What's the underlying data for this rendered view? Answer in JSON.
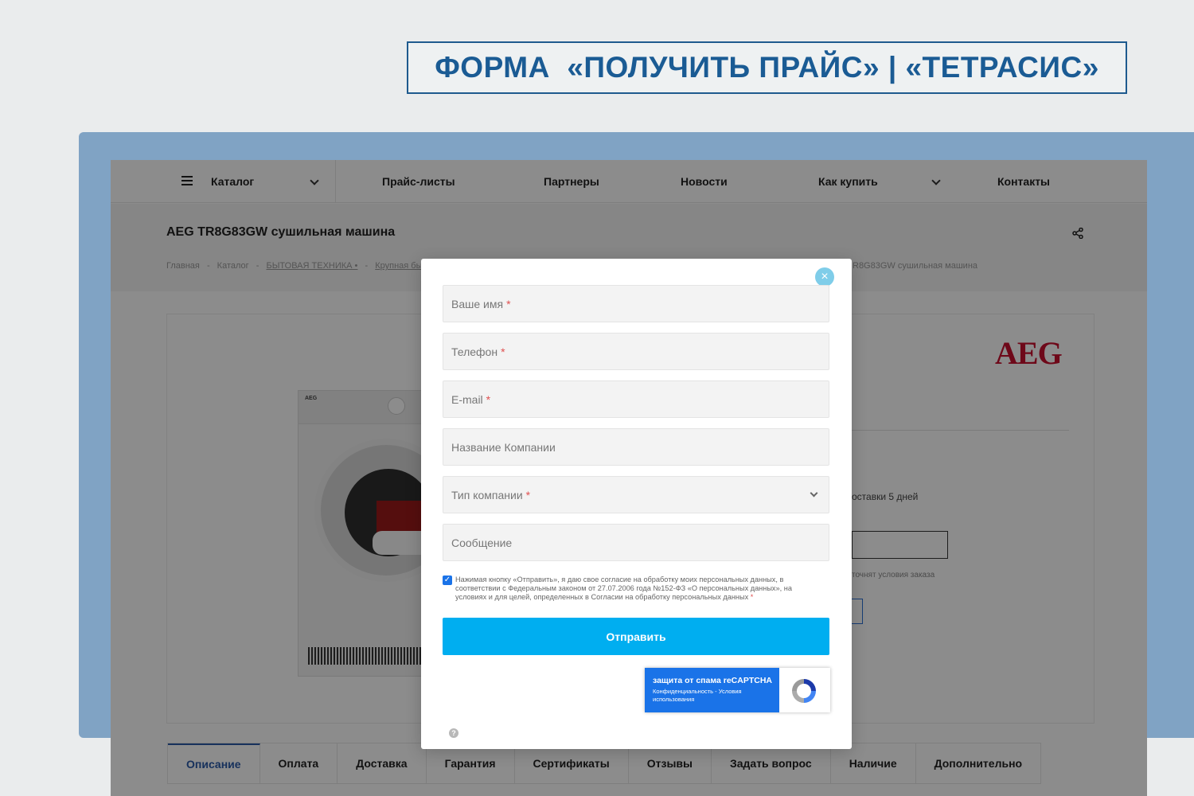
{
  "slide": {
    "title": "ФОРМА  «ПОЛУЧИТЬ ПРАЙС» | «ТЕТРАСИС»"
  },
  "nav": {
    "items": [
      "Каталог",
      "Прайс-листы",
      "Партнеры",
      "Новости",
      "Как купить",
      "Контакты"
    ]
  },
  "product": {
    "title": "AEG TR8G83GW сушильная машина",
    "breadcrumbs": [
      "Главная",
      "-",
      "Каталог",
      "-",
      "БЫТОВАЯ ТЕХНИКА •",
      "-",
      "Крупная бытова"
    ],
    "breadcrumb_tail": "R8G83GW сушильная машина",
    "brand": "AEG",
    "washer_brand": "AEG",
    "delivery": "оставки 5 дней",
    "terms_note": "точнят условия заказа"
  },
  "tabs": [
    "Описание",
    "Оплата",
    "Доставка",
    "Гарантия",
    "Сертификаты",
    "Отзывы",
    "Задать вопрос",
    "Наличие",
    "Дополнительно"
  ],
  "modal": {
    "close": "×",
    "fields": {
      "name": "Ваше имя",
      "phone": "Телефон",
      "email": "E-mail",
      "company": "Название Компании",
      "company_type": "Тип компании",
      "message": "Сообщение"
    },
    "required_mark": "*",
    "consent_text": "Нажимая кнопку «Отправить», я даю свое согласие на обработку моих персональных данных, в соответствии с Федеральным законом от 27.07.2006 года №152-ФЗ «О персональных данных», на условиях и для целей, определенных в Согласии на обработку персональных данных",
    "consent_checked": true,
    "submit": "Отправить",
    "recaptcha": {
      "title": "защита от спама reCAPTCHA",
      "links": "Конфиденциальность - Условия использования"
    },
    "help": "?"
  },
  "colors": {
    "accent": "#00aef0",
    "title_blue": "#1a5b94",
    "frame": "#80a3c4",
    "brand_red": "#c8102e",
    "recaptcha_blue": "#1a73e8"
  }
}
